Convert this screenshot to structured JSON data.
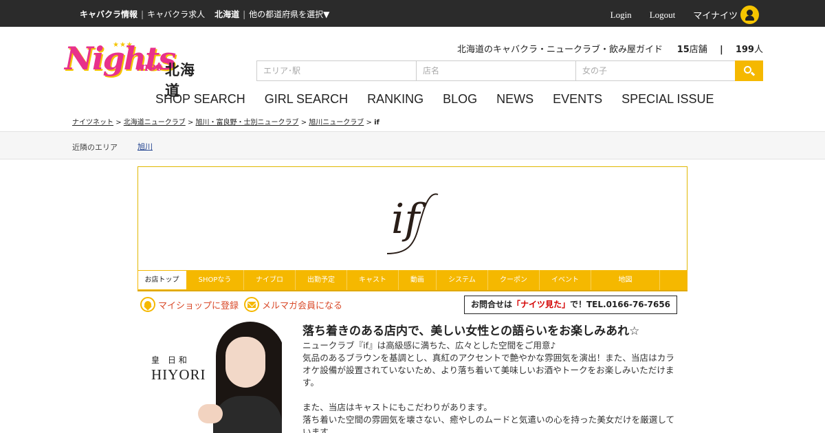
{
  "topbar": {
    "cabaret_info": "キャバクラ情報",
    "cabaret_jobs": "キャバクラ求人",
    "region": "北海道",
    "select_prefecture": "他の都道府県を選択▼",
    "login": "Login",
    "logout": "Logout",
    "my_nights": "マイナイツ"
  },
  "logo": {
    "brand": "Nights",
    "suffix": ".net",
    "region": "北海道"
  },
  "tagline": {
    "text": "北海道のキャバクラ・ニュークラブ・飲み屋ガイド",
    "shop_count": "15",
    "shop_unit": "店舗",
    "divider": "|",
    "girl_count": "199",
    "girl_unit": "人"
  },
  "search": {
    "area_placeholder": "エリア･駅",
    "shop_placeholder": "店名",
    "girl_placeholder": "女の子"
  },
  "nav": [
    "SHOP SEARCH",
    "GIRL SEARCH",
    "RANKING",
    "BLOG",
    "NEWS",
    "EVENTS",
    "SPECIAL ISSUE"
  ],
  "breadcrumb": {
    "items": [
      "ナイツネット",
      "北海道ニュークラブ",
      "旭川・富良野・士別ニュークラブ",
      "旭川ニュークラブ"
    ],
    "current": "if",
    "sep": ">"
  },
  "nearby": {
    "label": "近隣のエリア",
    "area": "旭川"
  },
  "shop": {
    "logo_text": "if"
  },
  "shop_tabs": [
    "お店トップ",
    "SHOPなう",
    "ナイブロ",
    "出勤予定",
    "キャスト",
    "動画",
    "システム",
    "クーポン",
    "イベント",
    "地図"
  ],
  "actions": {
    "register_shop": "マイショップに登録",
    "mailmag": "メルマガ会員になる"
  },
  "contact": {
    "prefix": "お問合せは",
    "highlight": "「ナイツ見た」",
    "suffix": "で！TEL.0166-76-7656"
  },
  "cast": {
    "name_jp": "皇 日和",
    "name_en": "HIYORI"
  },
  "description": {
    "headline": "落ち着きのある店内で、美しい女性との語らいをお楽しみあれ☆",
    "p1": "ニュークラブ『if』は高級感に満ちた、広々とした空間をご用意♪",
    "p2": "気品のあるブラウンを基調とし、真紅のアクセントで艶やかな雰囲気を演出！また、当店はカラオケ設備が設置されていないため、より落ち着いて美味しいお酒やトークをお楽しみいただけます。",
    "p3": "また、当店はキャストにもこだわりがあります。",
    "p4": "落ち着いた空間の雰囲気を壊さない、癒やしのムードと気遣いの心を持った美女だけを厳選しています。"
  },
  "colors": {
    "accent": "#f5b800",
    "brand_pink": "#e8318b",
    "topbar": "#2b2b2b",
    "link": "#1a3c8c"
  }
}
